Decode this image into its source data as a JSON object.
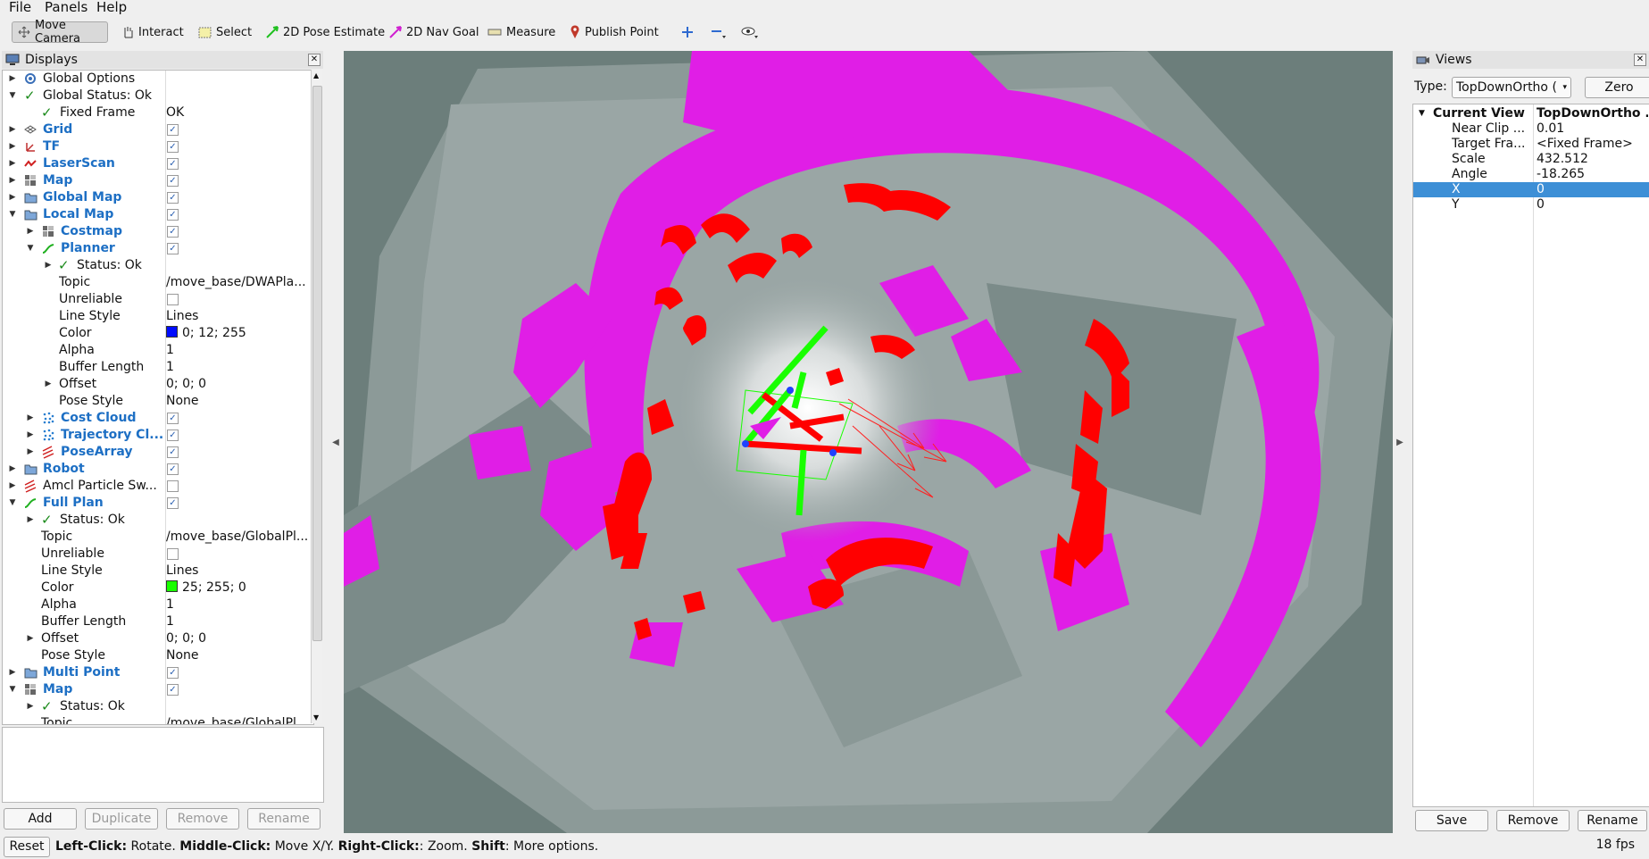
{
  "menu": {
    "file": "File",
    "panels": "Panels",
    "help": "Help"
  },
  "toolbar": {
    "move_camera": "Move Camera",
    "interact": "Interact",
    "select": "Select",
    "pose_estimate": "2D Pose Estimate",
    "nav_goal": "2D Nav Goal",
    "measure": "Measure",
    "publish_point": "Publish Point"
  },
  "displays": {
    "title": "Displays",
    "rows": [
      {
        "name": "Global Options",
        "value": ""
      },
      {
        "name": "Global Status: Ok",
        "value": ""
      },
      {
        "name": "Fixed Frame",
        "value": "OK"
      },
      {
        "name": "Grid",
        "value": ""
      },
      {
        "name": "TF",
        "value": ""
      },
      {
        "name": "LaserScan",
        "value": ""
      },
      {
        "name": "Map",
        "value": ""
      },
      {
        "name": "Global Map",
        "value": ""
      },
      {
        "name": "Local Map",
        "value": ""
      },
      {
        "name": "Costmap",
        "value": ""
      },
      {
        "name": "Planner",
        "value": ""
      },
      {
        "name": "Status: Ok",
        "value": ""
      },
      {
        "name": "Topic",
        "value": "/move_base/DWAPla..."
      },
      {
        "name": "Unreliable",
        "value": ""
      },
      {
        "name": "Line Style",
        "value": "Lines"
      },
      {
        "name": "Color",
        "value": "0; 12; 255"
      },
      {
        "name": "Alpha",
        "value": "1"
      },
      {
        "name": "Buffer Length",
        "value": "1"
      },
      {
        "name": "Offset",
        "value": "0; 0; 0"
      },
      {
        "name": "Pose Style",
        "value": "None"
      },
      {
        "name": "Cost Cloud",
        "value": ""
      },
      {
        "name": "Trajectory Cl...",
        "value": ""
      },
      {
        "name": "PoseArray",
        "value": ""
      },
      {
        "name": "Robot",
        "value": ""
      },
      {
        "name": "Amcl Particle Sw...",
        "value": ""
      },
      {
        "name": "Full Plan",
        "value": ""
      },
      {
        "name": "Status: Ok",
        "value": ""
      },
      {
        "name": "Topic",
        "value": "/move_base/GlobalPl..."
      },
      {
        "name": "Unreliable",
        "value": ""
      },
      {
        "name": "Line Style",
        "value": "Lines"
      },
      {
        "name": "Color",
        "value": "25; 255; 0"
      },
      {
        "name": "Alpha",
        "value": "1"
      },
      {
        "name": "Buffer Length",
        "value": "1"
      },
      {
        "name": "Offset",
        "value": "0; 0; 0"
      },
      {
        "name": "Pose Style",
        "value": "None"
      },
      {
        "name": "Multi Point",
        "value": ""
      },
      {
        "name": "Map",
        "value": ""
      },
      {
        "name": "Status: Ok",
        "value": ""
      },
      {
        "name": "Topic",
        "value": "/move_base/GlobalPl..."
      }
    ],
    "buttons": {
      "add": "Add",
      "duplicate": "Duplicate",
      "remove": "Remove",
      "rename": "Rename"
    }
  },
  "colors": {
    "planner_color": "#000cff",
    "full_plan_color": "#19ff00",
    "costmap_magenta": "#e01ee6",
    "obstacle_red": "#ff0000",
    "selection_blue": "#3d8fd6"
  },
  "views": {
    "title": "Views",
    "type_label": "Type:",
    "type_value": "TopDownOrtho (",
    "zero_button": "Zero",
    "rows": [
      {
        "key": "Current View",
        "value": "TopDownOrtho ..."
      },
      {
        "key": "Near Clip ...",
        "value": "0.01"
      },
      {
        "key": "Target Fra...",
        "value": "<Fixed Frame>"
      },
      {
        "key": "Scale",
        "value": "432.512"
      },
      {
        "key": "Angle",
        "value": "-18.265"
      },
      {
        "key": "X",
        "value": "0"
      },
      {
        "key": "Y",
        "value": "0"
      }
    ],
    "buttons": {
      "save": "Save",
      "remove": "Remove",
      "rename": "Rename"
    }
  },
  "status": {
    "reset": "Reset",
    "left_click": "Left-Click:",
    "left_text": " Rotate. ",
    "middle_click": "Middle-Click:",
    "middle_text": " Move X/Y. ",
    "right_click": "Right-Click:",
    "right_text": ": Zoom. ",
    "shift": "Shift",
    "shift_text": ": More options.",
    "fps": "18 fps"
  }
}
